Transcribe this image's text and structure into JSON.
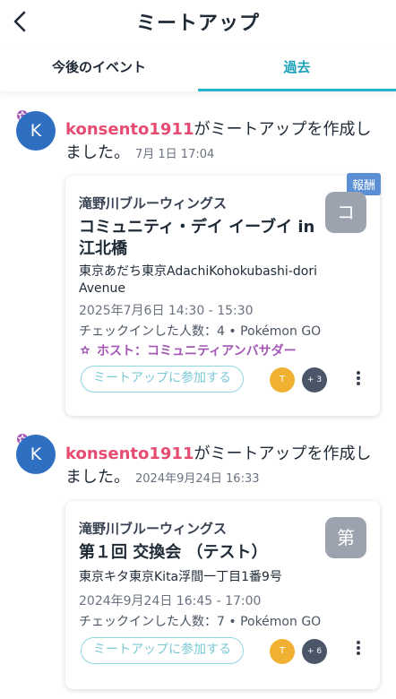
{
  "header": {
    "title": "ミートアップ"
  },
  "tabs": {
    "upcoming": "今後のイベント",
    "past": "過去"
  },
  "posts": [
    {
      "avatar_letter": "K",
      "username": "konsento1911",
      "action_text": "がミートアップを作成しました。",
      "timestamp": "7月 1日 17:04",
      "card": {
        "badge": "報酬",
        "organization": "滝野川ブルーウィングス",
        "title": "コミュニティ・デイ イーブイ in江北橋",
        "thumb": "コ",
        "location": "東京あだち東京AdachiKohokubashi-dori Avenue",
        "datetime": "2025年7月6日  14:30 - 15:30",
        "checkin": "チェックインした人数：4 • Pokémon GO",
        "host": "ホスト：コミュニティアンバサダー",
        "join": "ミートアップに参加する",
        "attendee": "T",
        "more_count": "+ 3"
      }
    },
    {
      "avatar_letter": "K",
      "username": "konsento1911",
      "action_text": "がミートアップを作成しました。",
      "timestamp": "2024年9月24日 16:33",
      "card": {
        "organization": "滝野川ブルーウィングス",
        "title": "第１回 交換会 （テスト）",
        "thumb": "第",
        "location": "東京キタ東京Kita浮間一丁目1番9号",
        "datetime": "2024年9月24日  16:45 - 17:00",
        "checkin": "チェックインした人数：7 • Pokémon GO",
        "join": "ミートアップに参加する",
        "attendee": "T",
        "more_count": "+ 6"
      }
    }
  ],
  "colors": {
    "accent": "#22b5cd",
    "username": "#e64c72",
    "host": "#a257b3",
    "avatar": "#2f6fc2"
  }
}
